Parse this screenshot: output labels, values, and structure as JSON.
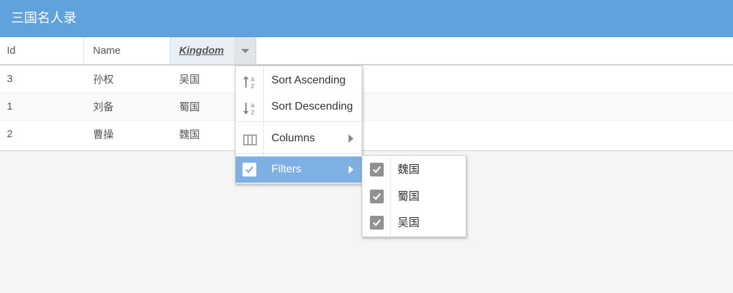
{
  "panel": {
    "title": "三国名人录"
  },
  "grid": {
    "columns": [
      {
        "label": "Id"
      },
      {
        "label": "Name"
      },
      {
        "label": "Kingdom"
      }
    ],
    "rows": [
      {
        "id": "3",
        "name": "孙权",
        "kingdom": "吴国"
      },
      {
        "id": "1",
        "name": "刘备",
        "kingdom": "蜀国"
      },
      {
        "id": "2",
        "name": "曹操",
        "kingdom": "魏国"
      }
    ]
  },
  "column_menu": {
    "items": [
      {
        "label": "Sort Ascending",
        "icon": "sort-ascending-icon"
      },
      {
        "label": "Sort Descending",
        "icon": "sort-descending-icon"
      },
      {
        "label": "Columns",
        "icon": "columns-icon"
      },
      {
        "label": "Filters",
        "icon": "checkbox-checked-icon",
        "active": true
      }
    ]
  },
  "filter_submenu": {
    "items": [
      {
        "label": "魏国",
        "checked": true
      },
      {
        "label": "蜀国",
        "checked": true
      },
      {
        "label": "吴国",
        "checked": true
      }
    ]
  },
  "colors": {
    "header_bg": "#5fa2dd",
    "active_menu_item": "#7fb0e3",
    "checkbox": "#919191"
  }
}
